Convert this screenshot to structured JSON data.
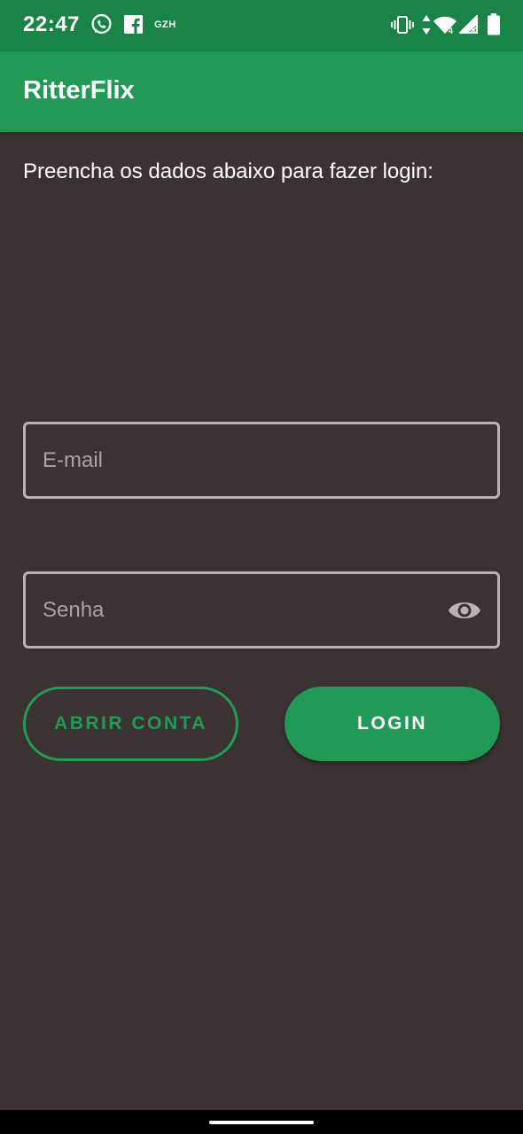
{
  "status_bar": {
    "time": "22:47",
    "notif_text": "GZH"
  },
  "app": {
    "title": "RitterFlix"
  },
  "form": {
    "instruction": "Preencha os dados abaixo para fazer login:",
    "email_placeholder": "E-mail",
    "email_value": "",
    "password_placeholder": "Senha",
    "password_value": ""
  },
  "buttons": {
    "create_account": "ABRIR CONTA",
    "login": "LOGIN"
  },
  "colors": {
    "status_bar": "#1a8446",
    "app_bar": "#219a55",
    "background": "#3b3333",
    "accent": "#219a55"
  }
}
